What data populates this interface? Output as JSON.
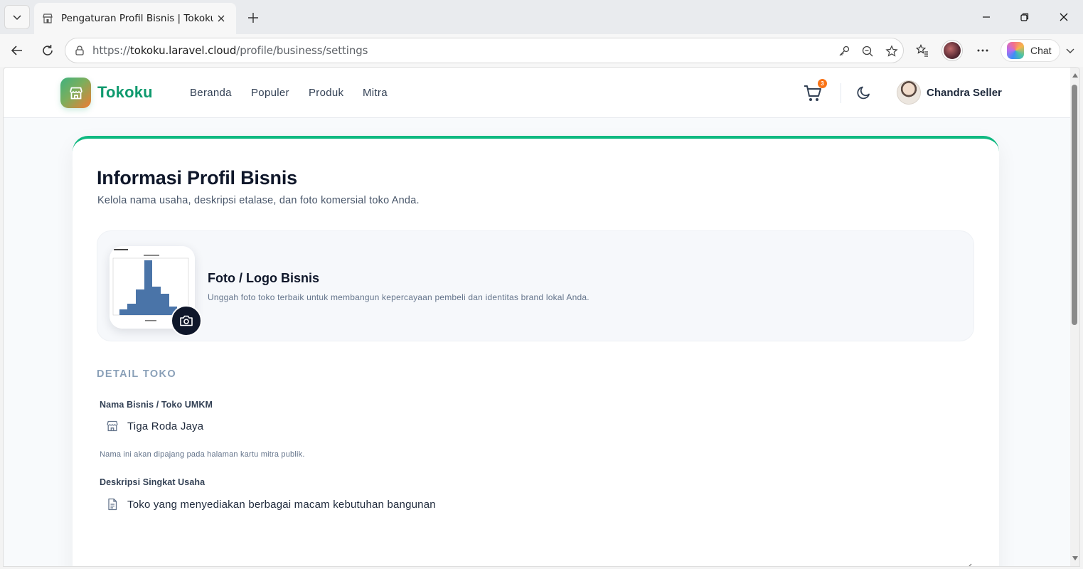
{
  "browser": {
    "tab_title": "Pengaturan Profil Bisnis | Tokoku",
    "url_prefix": "https://",
    "url_host": "tokoku.laravel.cloud",
    "url_path": "/profile/business/settings",
    "chat_label": "Chat"
  },
  "header": {
    "logo_text": "Tokoku",
    "nav": [
      "Beranda",
      "Populer",
      "Produk",
      "Mitra"
    ],
    "cart_count": "3",
    "user_name": "Chandra Seller"
  },
  "page": {
    "title": "Informasi Profil Bisnis",
    "subtitle": "Kelola nama usaha, deskripsi etalase, dan foto komersial toko Anda.",
    "photo": {
      "title": "Foto / Logo Bisnis",
      "description": "Unggah foto toko terbaik untuk membangun kepercayaan pembeli dan identitas brand lokal Anda."
    },
    "section_label": "DETAIL TOKO",
    "business_name": {
      "label": "Nama Bisnis / Toko UMKM",
      "value": "Tiga Roda Jaya",
      "helper": "Nama ini akan dipajang pada halaman kartu mitra publik."
    },
    "description": {
      "label": "Deskripsi Singkat Usaha",
      "value": "Toko yang menyediakan berbagai macam kebutuhan bangunan"
    }
  },
  "colors": {
    "accent": "#10b981",
    "brand_text": "#0f9a6e",
    "badge": "#f97316",
    "dark_button": "#0f172a"
  }
}
